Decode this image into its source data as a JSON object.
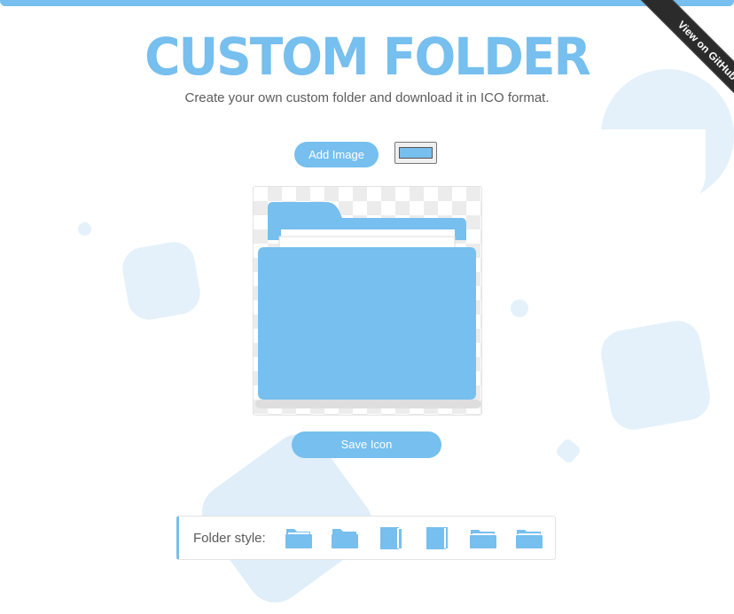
{
  "header": {
    "title": "CUSTOM FOLDER",
    "subtitle": "Create your own custom folder and download it in ICO format."
  },
  "ribbon": {
    "label": "View on GitHub"
  },
  "controls": {
    "add_image_label": "Add Image",
    "folder_color": "#76bfee",
    "save_label": "Save Icon"
  },
  "style_picker": {
    "label": "Folder style:",
    "styles": [
      "folder-style-1-icon",
      "folder-style-2-icon",
      "folder-style-3-icon",
      "folder-style-4-icon",
      "folder-style-5-icon",
      "folder-style-6-icon"
    ]
  },
  "colors": {
    "accent": "#76bfee",
    "deco": "#e4f1fb",
    "text": "#5a5a5a"
  }
}
